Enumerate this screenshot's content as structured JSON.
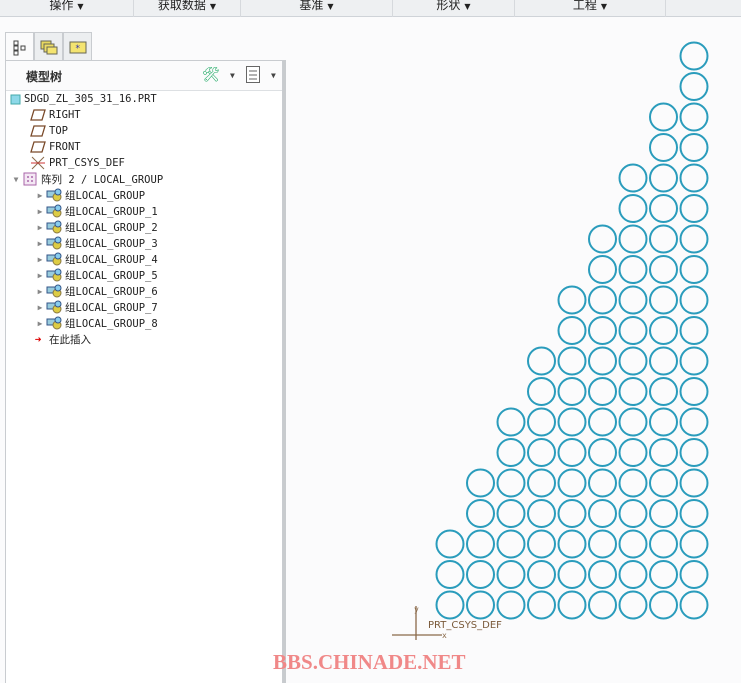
{
  "menubar": {
    "items": [
      {
        "label": "操作"
      },
      {
        "label": "获取数据"
      },
      {
        "label": "基准"
      },
      {
        "label": "形状"
      },
      {
        "label": "工程"
      }
    ]
  },
  "panel": {
    "title": "模型树"
  },
  "tree": {
    "root": "SDGD_ZL_305_31_16.PRT",
    "datums": [
      "RIGHT",
      "TOP",
      "FRONT",
      "PRT_CSYS_DEF"
    ],
    "pattern": "阵列 2 / LOCAL_GROUP",
    "groups": [
      "组LOCAL_GROUP",
      "组LOCAL_GROUP_1",
      "组LOCAL_GROUP_2",
      "组LOCAL_GROUP_3",
      "组LOCAL_GROUP_4",
      "组LOCAL_GROUP_5",
      "组LOCAL_GROUP_6",
      "组LOCAL_GROUP_7",
      "组LOCAL_GROUP_8"
    ],
    "insert": "在此插入"
  },
  "viewport": {
    "csys_label": "PRT_CSYS_DEF",
    "csys_axis_x": "x",
    "csys_axis_y": "y",
    "row_counts": [
      1,
      1,
      2,
      2,
      3,
      3,
      4,
      4,
      5,
      5,
      6,
      6,
      7,
      7,
      8,
      8,
      9,
      9,
      9
    ],
    "circle_color": "#2a9cbc"
  },
  "watermark": "BBS.CHINADE.NET"
}
